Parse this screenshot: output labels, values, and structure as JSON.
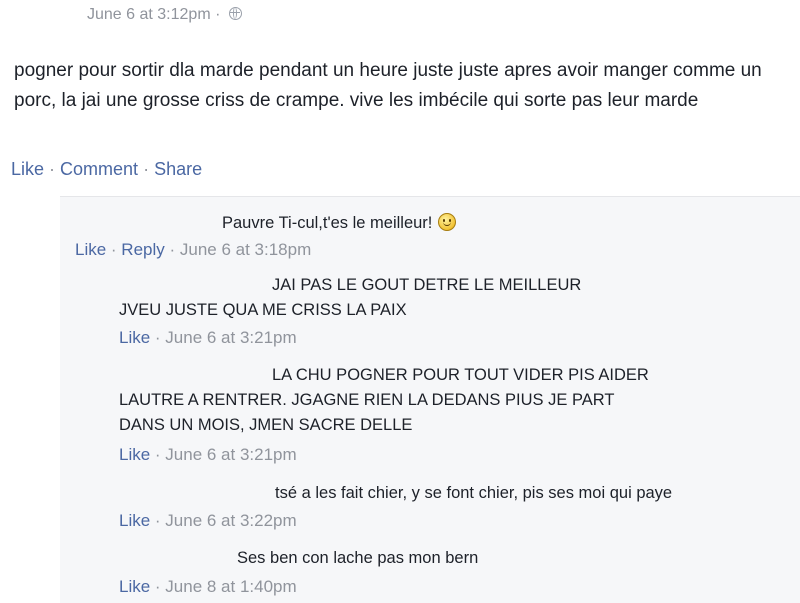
{
  "post": {
    "timestamp": "June 6 at 3:12pm",
    "separator": "·",
    "body": "pogner pour sortir dla marde pendant un heure juste juste apres avoir manger comme un porc, la jai une grosse criss de crampe. vive les imbécile qui sorte pas leur marde",
    "actions": {
      "like": "Like",
      "comment": "Comment",
      "share": "Share",
      "sep": " · "
    }
  },
  "comments": [
    {
      "lines": [
        "Pauvre Ti-cul,t'es le meilleur!"
      ],
      "like": "Like",
      "reply": "Reply",
      "time": "June 6 at 3:18pm"
    },
    {
      "lines": [
        "JAI PAS LE GOUT DETRE LE MEILLEUR",
        "JVEU JUSTE QUA ME CRISS LA PAIX"
      ],
      "like": "Like",
      "time": "June 6 at 3:21pm"
    },
    {
      "lines": [
        "LA CHU POGNER POUR TOUT VIDER PIS AIDER",
        "LAUTRE A RENTRER. JGAGNE RIEN LA DEDANS PIUS JE PART",
        "DANS UN MOIS, JMEN SACRE DELLE"
      ],
      "like": "Like",
      "time": "June 6 at 3:21pm"
    },
    {
      "lines": [
        "tsé a les fait chier, y se font chier, pis ses moi qui paye"
      ],
      "like": "Like",
      "time": "June 6 at 3:22pm"
    },
    {
      "lines": [
        "Ses ben con lache pas mon bern"
      ],
      "like": "Like",
      "time": "June 8 at 1:40pm"
    }
  ],
  "meta_sep": " · ",
  "icons": {
    "globe": "globe-icon",
    "emoji": "smiley-emoji-icon"
  },
  "colors": {
    "link": "#4b68a3",
    "meta": "#90949c",
    "comments_bg": "#f6f7f9"
  }
}
